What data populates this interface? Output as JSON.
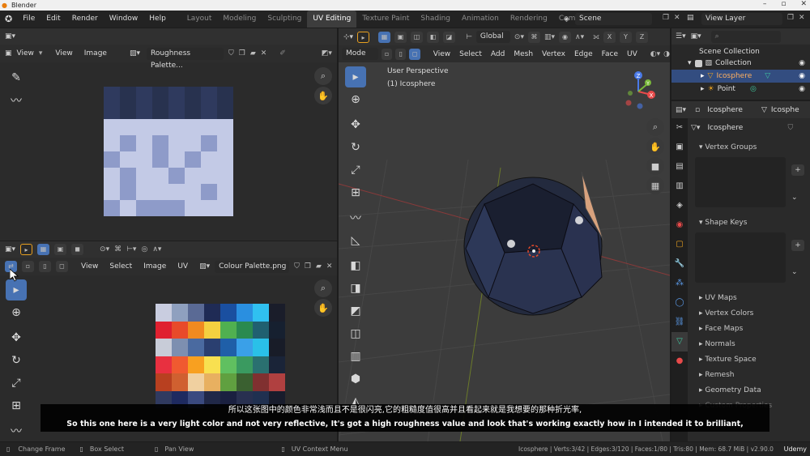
{
  "window": {
    "title": "Blender"
  },
  "menu": [
    "File",
    "Edit",
    "Render",
    "Window",
    "Help"
  ],
  "workspaces": [
    "Layout",
    "Modeling",
    "Sculpting",
    "UV Editing",
    "Texture Paint",
    "Shading",
    "Animation",
    "Rendering",
    "Comp"
  ],
  "active_workspace": "UV Editing",
  "scene": "Scene",
  "view_layer": "View Layer",
  "top_image_editor": {
    "menus": [
      "View",
      "View",
      "Image"
    ],
    "image_name": "Roughness Palette...",
    "swatches": {
      "dark": "#2f3a5e",
      "light": "#c3cae6",
      "mid": "#8e9bc9"
    }
  },
  "bottom_uv_editor": {
    "menus": [
      "View",
      "Select",
      "Image",
      "UV"
    ],
    "image_name": "Colour Palette.png"
  },
  "viewport": {
    "mode": "Mode",
    "menus": [
      "View",
      "Select",
      "Add",
      "Mesh",
      "Vertex",
      "Edge",
      "Face",
      "UV"
    ],
    "perspective_label": "User Perspective",
    "object_label": "(1) Icosphere",
    "transform": "Global",
    "axes": [
      "X",
      "Y",
      "Z"
    ],
    "gizmo": {
      "x": "X",
      "y": "Y",
      "z": "Z"
    }
  },
  "outliner": {
    "root": "Scene Collection",
    "collection": "Collection",
    "items": [
      "Icosphere",
      "Point"
    ]
  },
  "properties": {
    "object_name": "Icosphere",
    "object_name_trunc": "Icosphe",
    "mesh_name": "Icosphere",
    "sections": [
      "Vertex Groups",
      "Shape Keys",
      "UV Maps",
      "Vertex Colors",
      "Face Maps",
      "Normals",
      "Texture Space",
      "Remesh",
      "Geometry Data",
      "Custom Properties"
    ]
  },
  "statusbar": {
    "items": [
      "Change Frame",
      "Box Select",
      "Pan View",
      "UV Context Menu"
    ],
    "stats": "Icosphere | Verts:3/42 | Edges:3/120 | Faces:1/80 | Tris:80 | Mem: 68.7 MiB | v2.90.0",
    "brand": "Udemy"
  },
  "subtitles": {
    "cn": "所以这张图中的颜色非常浅而且不是很闪亮,它的粗糙度值很高并且看起来就是我想要的那种折光率,",
    "en": "So this one here is a very light color and not very reflective, It's got a high roughness value and look that's working exactly how in I intended it to brilliant,"
  },
  "palette_colors": [
    "#c9cde0",
    "#8fa0bf",
    "#5a6a95",
    "#1f2b55",
    "#1a4fa0",
    "#2a8fe0",
    "#30c0f0",
    "#1a1d2a",
    "#e02030",
    "#e84a2a",
    "#f08a20",
    "#f4d040",
    "#50b050",
    "#2a8a50",
    "#206070",
    "#162030",
    "#c8ccd8",
    "#7d8fb0",
    "#4a6aa0",
    "#2a3f70",
    "#1f5fa8",
    "#3aa0e8",
    "#2ac0e8",
    "#181c28",
    "#e83040",
    "#f05a30",
    "#f8a020",
    "#f8e050",
    "#60c060",
    "#3a9a60",
    "#2a7070",
    "#1a2438",
    "#b84020",
    "#d06030",
    "#f0d0a0",
    "#e8b060",
    "#60a040",
    "#3a6030",
    "#803030",
    "#b04040"
  ]
}
